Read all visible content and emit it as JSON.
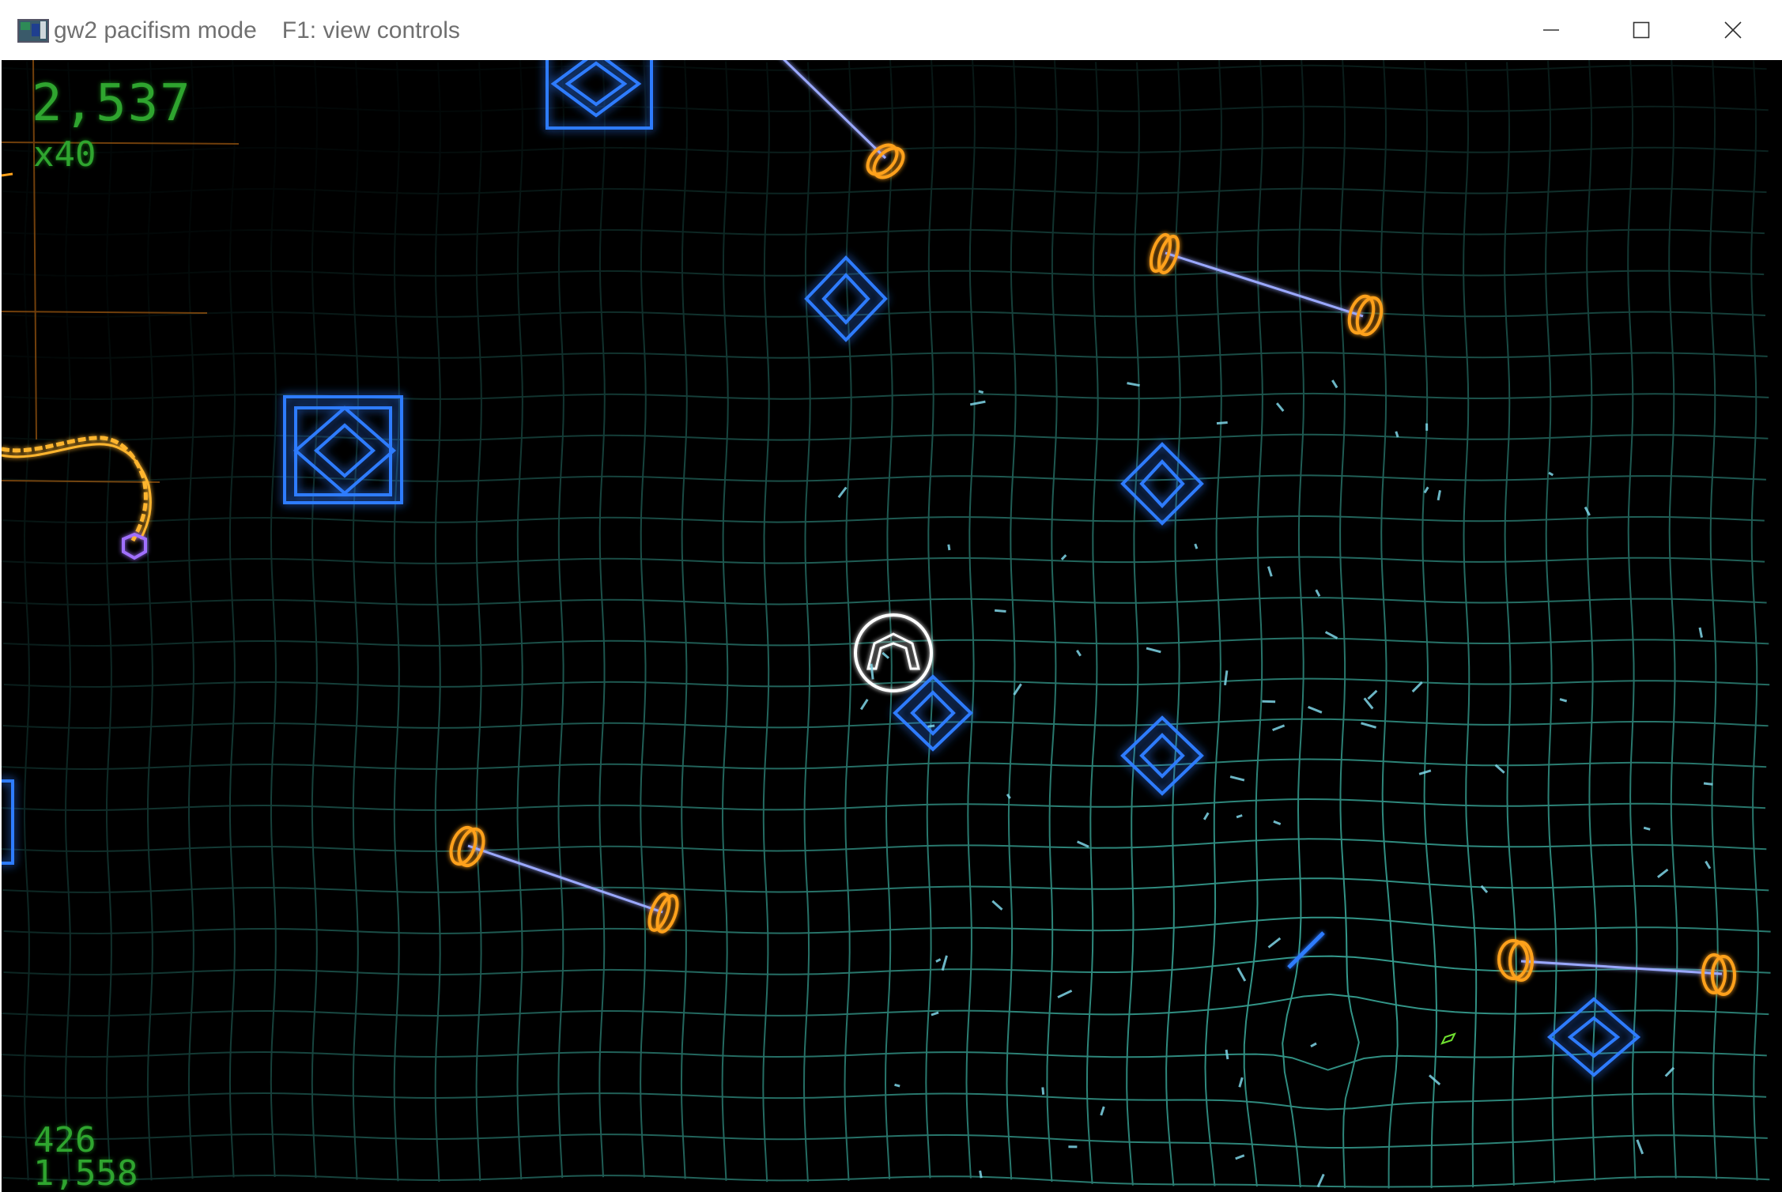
{
  "window": {
    "title": "gw2 pacifism mode",
    "hint": "F1: view controls"
  },
  "hud": {
    "score": "2,537",
    "multiplier": "x40",
    "stat_geoms": "426",
    "stat_total": "1,558"
  },
  "icons": {
    "app": "app-icon",
    "minimize": "minimize-icon",
    "maximize": "maximize-icon",
    "close": "close-icon"
  },
  "colors": {
    "grid": "#3fb8a8",
    "diamond": "#2f7bff",
    "gate_post": "#ffa11a",
    "gate_beam": "#9aa8ff",
    "snake": "#ffb52e",
    "player": "#ffffff",
    "hud": "#2fa52f"
  }
}
